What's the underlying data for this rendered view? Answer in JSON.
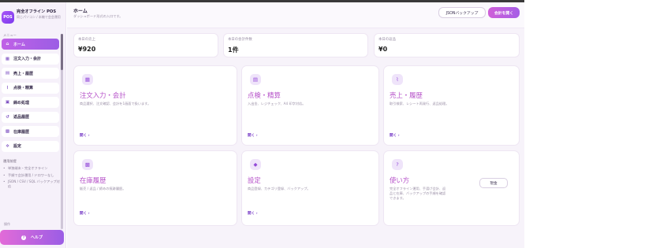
{
  "app": {
    "logo": "POS",
    "title": "完全オフライン POS",
    "subtitle": "同じパソコン / 本機で会会運用"
  },
  "sidebar": {
    "menu_label": "メニュー",
    "items": [
      {
        "label": "ホーム",
        "icon": "home-icon",
        "active": true
      },
      {
        "label": "注文入力・会計",
        "icon": "cash-register-icon",
        "active": false
      },
      {
        "label": "売上・履歴",
        "icon": "receipt-icon",
        "active": false
      },
      {
        "label": "点検・精算",
        "icon": "chart-icon",
        "active": false
      },
      {
        "label": "締め処理",
        "icon": "register-close-icon",
        "active": false
      },
      {
        "label": "返品履歴",
        "icon": "return-icon",
        "active": false
      },
      {
        "label": "在庫履歴",
        "icon": "boxes-icon",
        "active": false
      },
      {
        "label": "設定",
        "icon": "gear-icon",
        "active": false
      }
    ],
    "ops_title": "運用前提",
    "ops_items": [
      "単独端末・完全オフライン",
      "手順で会計運用 / ドロワーなし",
      "JSON / CSV / SQL バックアップ対応"
    ],
    "ops_footer": "操作",
    "help_label": "ヘルプ",
    "help_icon": "question-icon"
  },
  "header": {
    "title": "ホーム",
    "subtitle": "ダッシュボード形式の入口です。",
    "json_button": "JSONバックアップ",
    "accounting_button": "会計を開く"
  },
  "stats": [
    {
      "label": "本日の売上",
      "value": "¥920"
    },
    {
      "label": "本日の会計件数",
      "value": "1件"
    },
    {
      "label": "本日の返品",
      "value": "¥0"
    }
  ],
  "cards": [
    {
      "title": "注文入力・会計",
      "desc": "商品選択、注文確認、会計を1画面で扱います。",
      "open": "開く ›",
      "icon": "calculator-icon",
      "glyph": "▦"
    },
    {
      "title": "点検・精算",
      "desc": "入出金、レジチェック、A4 印字対応。",
      "open": "開く ›",
      "icon": "clipboard-icon",
      "glyph": "▤"
    },
    {
      "title": "売上・履歴",
      "desc": "取引検索、レシート再発行、返品処理。",
      "open": "開く ›",
      "icon": "trend-icon",
      "glyph": "⌇"
    },
    {
      "title": "在庫履歴",
      "desc": "販売 / 返品 / 締めの痕跡履歴。",
      "open": "開く ›",
      "icon": "boxes-icon",
      "glyph": "▩"
    },
    {
      "title": "設定",
      "desc": "商品登録、カテゴリ登録、バックアップ。",
      "open": "開く ›",
      "icon": "tag-icon",
      "glyph": "◆"
    },
    {
      "title": "使い方",
      "desc": "完全オフライン運用、手渡げ会計、返品と在庫、バックアップの手順を確認できます。",
      "open": "",
      "icon": "question-icon",
      "glyph": "?",
      "side_button": "現金"
    }
  ],
  "colors": {
    "accent": "#b652c9",
    "active_gradient_start": "#c061e6",
    "active_gradient_end": "#9b5de5",
    "link": "#7a3fc8"
  }
}
